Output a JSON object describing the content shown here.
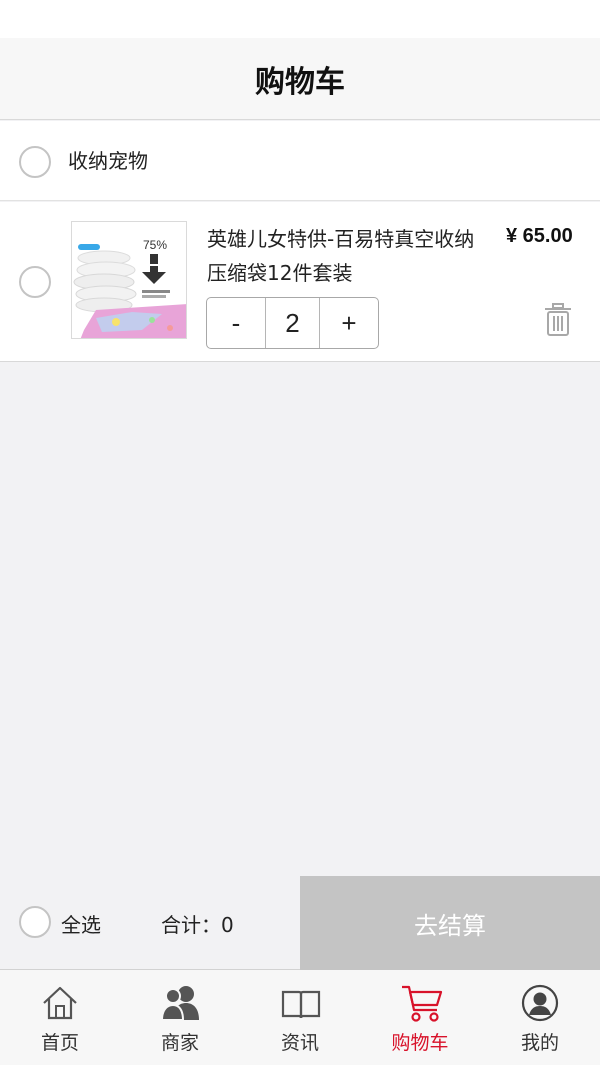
{
  "header": {
    "title": "购物车"
  },
  "shop": {
    "name": "收纳宠物"
  },
  "item": {
    "title": "英雄儿女特供-百易特真空收纳压缩袋12件套装",
    "price": "¥ 65.00",
    "quantity": "2",
    "decrement_label": "-",
    "increment_label": "+",
    "thumb_text": "75%"
  },
  "footer": {
    "select_all_label": "全选",
    "total_label": "合计：0",
    "checkout_label": "去结算"
  },
  "tabs": [
    {
      "label": "首页",
      "icon": "home-icon"
    },
    {
      "label": "商家",
      "icon": "merchants-icon"
    },
    {
      "label": "资讯",
      "icon": "book-icon"
    },
    {
      "label": "购物车",
      "icon": "cart-icon",
      "active": true
    },
    {
      "label": "我的",
      "icon": "user-icon"
    }
  ],
  "colors": {
    "accent": "#d8122a",
    "checkout_disabled": "#c4c4c4"
  }
}
